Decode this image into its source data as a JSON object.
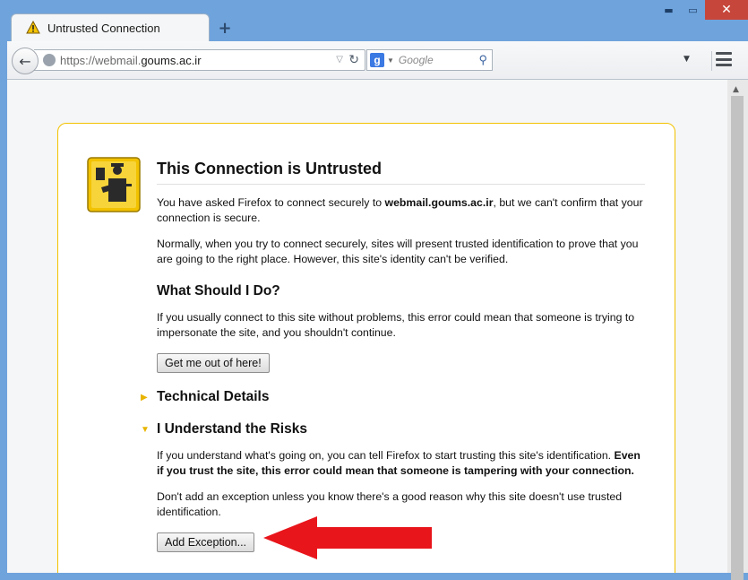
{
  "window": {
    "minimize_glyph": "▬",
    "maximize_glyph": "▭",
    "close_glyph": "✕"
  },
  "tab": {
    "title": "Untrusted Connection",
    "icon": "warning-triangle-icon",
    "new_tab_glyph": "+"
  },
  "toolbar": {
    "url_prefix": "https://webmail.",
    "url_host": "goums.ac.ir",
    "search_engine_letter": "g",
    "search_placeholder": "Google",
    "back_glyph": "←",
    "reload_glyph": "↻",
    "search_glyph": "⚲",
    "url_drop_glyph": "▽",
    "toolbar_drop_glyph": "▼"
  },
  "error": {
    "title": "This Connection is Untrusted",
    "intro_before": "You have asked Firefox to connect securely to ",
    "intro_host": "webmail.goums.ac.ir",
    "intro_after": ", but we can't confirm that your connection is secure.",
    "normally": "Normally, when you try to connect securely, sites will present trusted identification to prove that you are going to the right place. However, this site's identity can't be verified.",
    "what_heading": "What Should I Do?",
    "what_text": "If you usually connect to this site without problems, this error could mean that someone is trying to impersonate the site, and you shouldn't continue.",
    "get_me_out_label": "Get me out of here!",
    "technical_details": "Technical Details",
    "understand_risks": "I Understand the Risks",
    "risks_text_plain": "If you understand what's going on, you can tell Firefox to start trusting this site's identification. ",
    "risks_text_bold": "Even if you trust the site, this error could mean that someone is tampering with your connection.",
    "exception_note": "Don't add an exception unless you know there's a good reason why this site doesn't use trusted identification.",
    "add_exception_label": "Add Exception...",
    "collapsed_arrow": "▶",
    "expanded_arrow": "▼"
  },
  "colors": {
    "frame": "#6fa3dc",
    "close": "#c7463b",
    "box_border": "#f2c200",
    "annotation_arrow": "#e8151b"
  }
}
